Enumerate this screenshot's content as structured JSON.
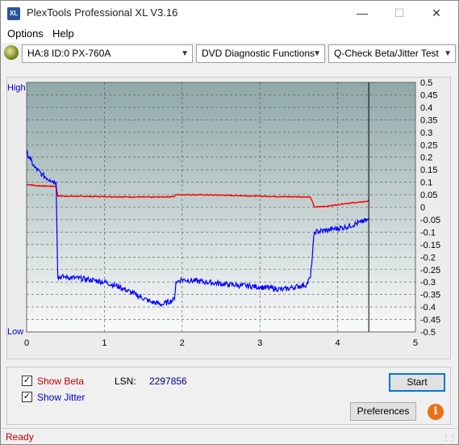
{
  "window": {
    "title": "PlexTools Professional XL V3.16",
    "app_icon_text": "XL"
  },
  "menu": {
    "options": "Options",
    "help": "Help"
  },
  "toolbar": {
    "drive": "HA:8 ID:0  PX-760A",
    "function": "DVD Diagnostic Functions",
    "test": "Q-Check Beta/Jitter Test"
  },
  "colors": {
    "beta": "#ff0000",
    "jitter": "#0000ff",
    "plot_top": "#8fa8a8",
    "plot_bottom": "#fafafa",
    "status": "#c00000"
  },
  "chart_data": {
    "type": "line",
    "title": "",
    "left_axis": {
      "top_label": "High",
      "bottom_label": "Low"
    },
    "x_ticks": [
      "0",
      "1",
      "2",
      "3",
      "4",
      "5"
    ],
    "xlim": [
      0,
      5
    ],
    "y_ticks": [
      "0.5",
      "0.45",
      "0.4",
      "0.35",
      "0.3",
      "0.25",
      "0.2",
      "0.15",
      "0.1",
      "0.05",
      "0",
      "-0.05",
      "-0.1",
      "-0.15",
      "-0.2",
      "-0.25",
      "-0.3",
      "-0.35",
      "-0.4",
      "-0.45",
      "-0.5"
    ],
    "ylim": [
      -0.5,
      0.5
    ],
    "end_marker_x": 4.4,
    "series": [
      {
        "name": "Beta",
        "x": [
          0,
          0.05,
          0.1,
          0.2,
          0.3,
          0.38,
          0.4,
          0.5,
          0.8,
          1.0,
          1.3,
          1.6,
          1.9,
          1.92,
          2.1,
          2.5,
          3.0,
          3.3,
          3.6,
          3.65,
          3.7,
          3.9,
          4.1,
          4.3,
          4.4
        ],
        "y": [
          0.09,
          0.09,
          0.087,
          0.085,
          0.084,
          0.083,
          0.045,
          0.044,
          0.043,
          0.042,
          0.041,
          0.04,
          0.042,
          0.05,
          0.05,
          0.048,
          0.044,
          0.042,
          0.041,
          0.04,
          0.0,
          0.005,
          0.015,
          0.02,
          0.025
        ]
      },
      {
        "name": "Jitter",
        "x": [
          0,
          0.05,
          0.1,
          0.2,
          0.3,
          0.38,
          0.4,
          0.5,
          0.8,
          1.0,
          1.2,
          1.4,
          1.6,
          1.75,
          1.9,
          1.92,
          2.0,
          2.3,
          2.6,
          3.0,
          3.3,
          3.6,
          3.65,
          3.7,
          3.9,
          4.1,
          4.3,
          4.4
        ],
        "y": [
          0.22,
          0.19,
          0.16,
          0.13,
          0.11,
          0.1,
          -0.28,
          -0.28,
          -0.29,
          -0.3,
          -0.32,
          -0.35,
          -0.38,
          -0.39,
          -0.37,
          -0.3,
          -0.29,
          -0.3,
          -0.31,
          -0.32,
          -0.33,
          -0.31,
          -0.28,
          -0.1,
          -0.09,
          -0.08,
          -0.06,
          -0.05
        ]
      }
    ]
  },
  "bottom": {
    "show_beta": "Show Beta",
    "show_jitter": "Show Jitter",
    "lsn_label": "LSN:",
    "lsn_value": "2297856",
    "start": "Start",
    "preferences": "Preferences",
    "info": "i",
    "check_mark": "✓"
  },
  "status": {
    "text": "Ready"
  }
}
